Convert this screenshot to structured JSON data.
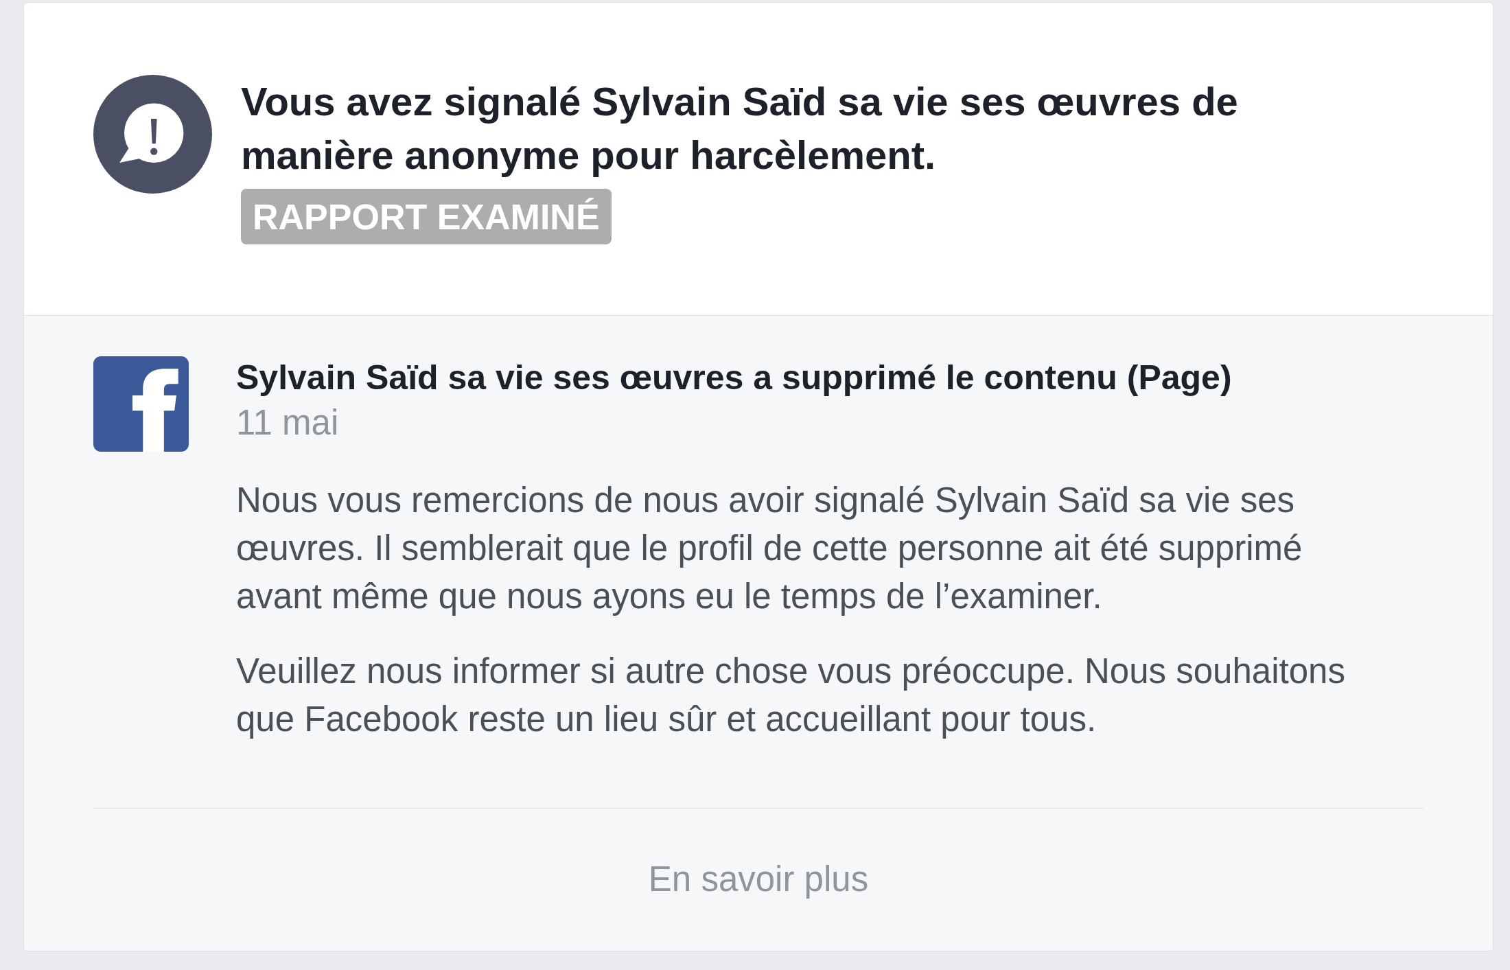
{
  "report": {
    "heading": "Vous avez signalé Sylvain Saïd sa vie ses œuvres de manière anonyme pour harcèlement.",
    "status": "RAPPORT EXAMINÉ"
  },
  "update": {
    "title": "Sylvain Saïd sa vie ses œuvres a supprimé le contenu (Page)",
    "date": "11 mai",
    "paragraphs": [
      "Nous vous remercions de nous avoir signalé Sylvain Saïd sa vie ses œuvres. Il semblerait que le profil de cette personne ait été supprimé avant même que nous ayons eu le temps de l’examiner.",
      "Veuillez nous informer si autre chose vous préoccupe. Nous souhaitons que Facebook reste un lieu sûr et accueillant pour tous."
    ]
  },
  "footer": {
    "link": "En savoir plus"
  }
}
